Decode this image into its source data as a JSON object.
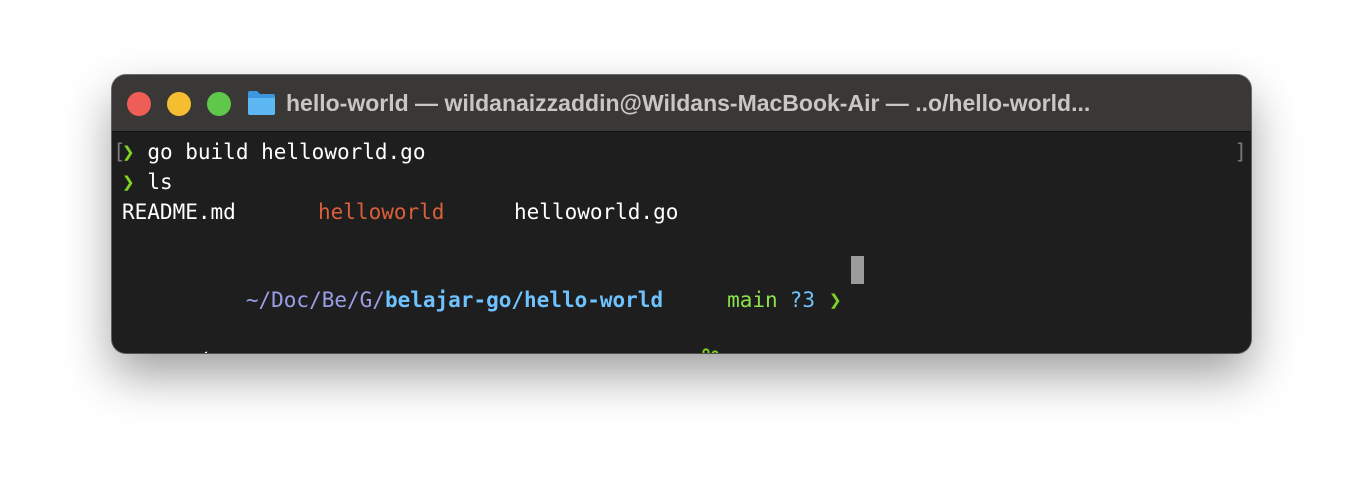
{
  "window": {
    "title": "hello-world — wildanaizzaddin@Wildans-MacBook-Air — ..o/hello-world..."
  },
  "terminal": {
    "lines": [
      {
        "prompt": "❯",
        "command": "go build helloworld.go"
      },
      {
        "prompt": "❯",
        "command": "ls"
      }
    ],
    "ls_output": [
      {
        "name": "README.md",
        "type": "file"
      },
      {
        "name": "helloworld",
        "type": "executable"
      },
      {
        "name": "helloworld.go",
        "type": "file"
      }
    ],
    "prompt_line": {
      "os_icon": "apple-icon",
      "folder_icon": "folder-open-icon",
      "path_prefix": "~/Doc/Be/G/",
      "path_bold": "belajar-go/hello-world",
      "git_icon": "github-octocat-icon",
      "branch_icon": "git-branch-icon",
      "branch": "main",
      "status": "?3",
      "prompt": "❯"
    },
    "brackets": {
      "left": "[",
      "right": "]"
    }
  },
  "colors": {
    "prompt_green": "#7ed321",
    "executable": "#d9603a",
    "path_bold": "#6ec3ff",
    "path_dim": "#9a9ee6",
    "background": "#1e1e1e",
    "titlebar": "#3a3837"
  }
}
